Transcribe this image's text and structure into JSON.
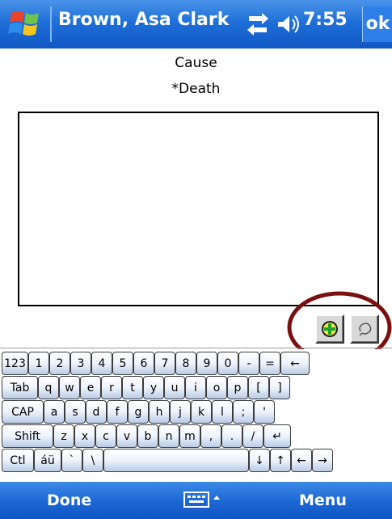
{
  "titlebar": {
    "title": "Brown, Asa Clark",
    "clock": "7:55",
    "ok_label": "ok",
    "icons": [
      "windows-start-icon",
      "connectivity-icon",
      "volume-icon"
    ]
  },
  "form": {
    "heading": "Cause",
    "field_label": "*Death",
    "field_value": ""
  },
  "action_buttons": [
    "add-icon",
    "clear-icon"
  ],
  "keyboard": {
    "rows": [
      [
        "123",
        "1",
        "2",
        "3",
        "4",
        "5",
        "6",
        "7",
        "8",
        "9",
        "0",
        "-",
        "=",
        "←"
      ],
      [
        "Tab",
        "q",
        "w",
        "e",
        "r",
        "t",
        "y",
        "u",
        "i",
        "o",
        "p",
        "[",
        "]"
      ],
      [
        "CAP",
        "a",
        "s",
        "d",
        "f",
        "g",
        "h",
        "j",
        "k",
        "l",
        ";",
        "'"
      ],
      [
        "Shift",
        "z",
        "x",
        "c",
        "v",
        "b",
        "n",
        "m",
        ",",
        ".",
        "/",
        "↵"
      ],
      [
        "Ctl",
        "áü",
        "`",
        "\\",
        "",
        "↓",
        "↑",
        "←",
        "→"
      ]
    ]
  },
  "bottombar": {
    "left_softkey": "Done",
    "right_softkey": "Menu",
    "sip_icon": "keyboard-icon"
  },
  "colors": {
    "titlebar_blue": "#1f6fd9",
    "highlight_ellipse": "#7a1010"
  }
}
